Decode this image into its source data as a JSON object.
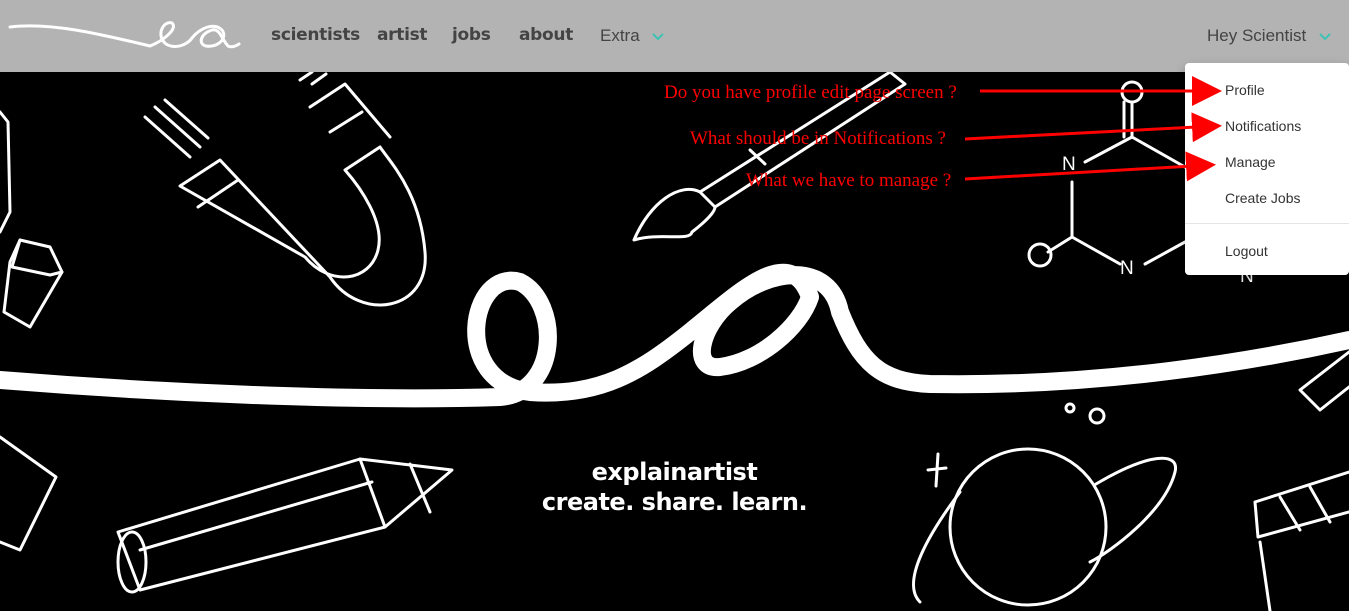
{
  "nav": {
    "links": [
      "scientists",
      "artist",
      "jobs",
      "about"
    ],
    "extra_label": "Extra",
    "user_greeting": "Hey Scientist"
  },
  "hero": {
    "tagline_line1": "explainartist",
    "tagline_line2": "create. share. learn."
  },
  "user_dropdown": {
    "items": [
      "Profile",
      "Notifications",
      "Manage",
      "Create Jobs"
    ],
    "logout_label": "Logout"
  },
  "annotations": [
    "Do you have profile edit page screen ?",
    "What should be in Notifications ?",
    "What we have to manage ?"
  ],
  "colors": {
    "navbar_bg": "#b3b3b3",
    "accent_teal": "#3cc3b4",
    "annotation_red": "#ff0000",
    "hero_bg": "#000000"
  },
  "molecule_labels": [
    "N",
    "N",
    "N"
  ]
}
